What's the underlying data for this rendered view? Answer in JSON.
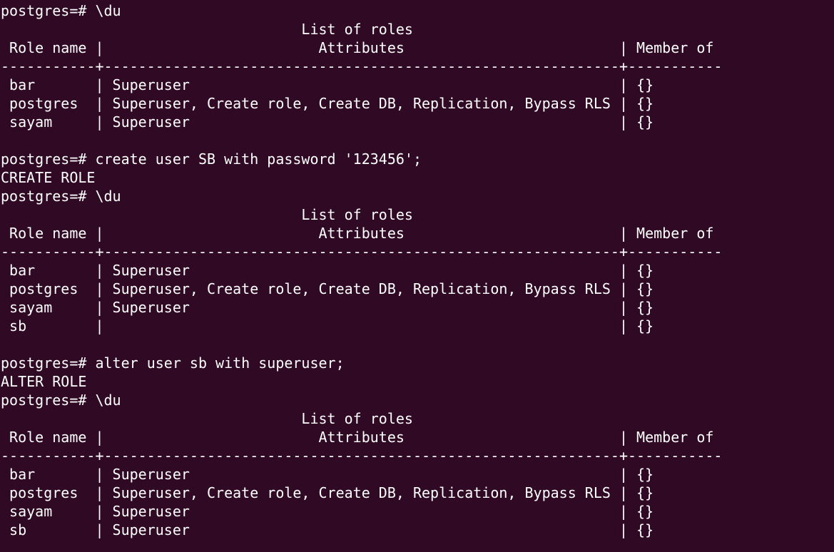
{
  "terminal": {
    "background": "#300a24",
    "foreground": "#ffffff",
    "lines": [
      "postgres=# \\du",
      "                                   List of roles",
      " Role name |                         Attributes                         | Member of ",
      "-----------+------------------------------------------------------------+-----------",
      " bar       | Superuser                                                  | {}",
      " postgres  | Superuser, Create role, Create DB, Replication, Bypass RLS | {}",
      " sayam     | Superuser                                                  | {}",
      "",
      "postgres=# create user SB with password '123456';",
      "CREATE ROLE",
      "postgres=# \\du",
      "                                   List of roles",
      " Role name |                         Attributes                         | Member of ",
      "-----------+------------------------------------------------------------+-----------",
      " bar       | Superuser                                                  | {}",
      " postgres  | Superuser, Create role, Create DB, Replication, Bypass RLS | {}",
      " sayam     | Superuser                                                  | {}",
      " sb        |                                                            | {}",
      "",
      "postgres=# alter user sb with superuser;",
      "ALTER ROLE",
      "postgres=# \\du",
      "                                   List of roles",
      " Role name |                         Attributes                         | Member of ",
      "-----------+------------------------------------------------------------+-----------",
      " bar       | Superuser                                                  | {}",
      " postgres  | Superuser, Create role, Create DB, Replication, Bypass RLS | {}",
      " sayam     | Superuser                                                  | {}",
      " sb        | Superuser                                                  | {}"
    ]
  }
}
